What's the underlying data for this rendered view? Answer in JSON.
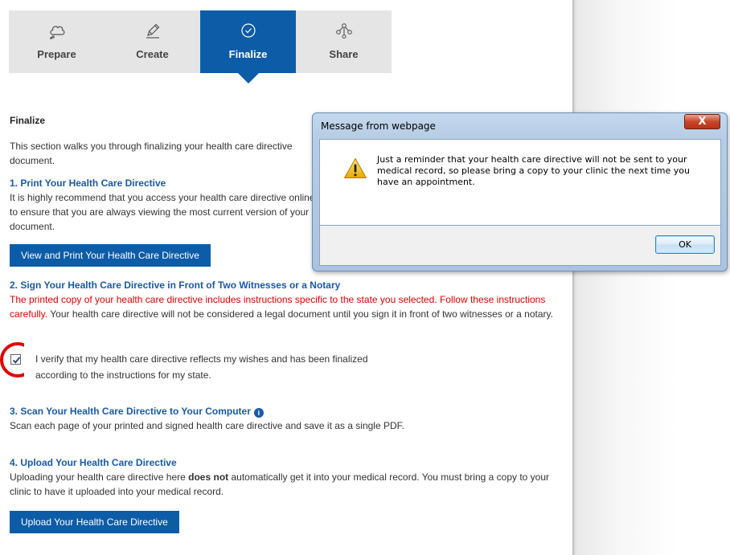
{
  "tabs": [
    {
      "label": "Prepare",
      "icon": "cloud-icon",
      "active": false
    },
    {
      "label": "Create",
      "icon": "pencil-icon",
      "active": false
    },
    {
      "label": "Finalize",
      "icon": "check-circle-icon",
      "active": true
    },
    {
      "label": "Share",
      "icon": "share-nodes-icon",
      "active": false
    }
  ],
  "content": {
    "heading": "Finalize",
    "intro": "This section walks you through finalizing your health care directive document.",
    "step1": {
      "title": "1. Print Your Health Care Directive",
      "text": "It is highly recommend that you access your health care directive online to ensure that you are always viewing the most current version of your document.",
      "button": "View and Print Your Health Care Directive"
    },
    "step2": {
      "title": "2. Sign Your Health Care Directive in Front of Two Witnesses or a Notary",
      "warning": "The printed copy of your health care directive includes instructions specific to the state you selected. Follow these instructions carefully.",
      "text": " Your health care directive will not be considered a legal document until you sign it in front of two witnesses or a notary.",
      "verify_line1": "I verify that my health care directive reflects my wishes and has been finalized",
      "verify_line2": "according to the instructions for my state.",
      "checked": true
    },
    "step3": {
      "title": "3. Scan Your Health Care Directive to Your Computer",
      "text": "Scan each page of your printed and signed health care directive and save it as a single PDF."
    },
    "step4": {
      "title": "4. Upload Your Health Care Directive",
      "text_before": "Uploading your health care directive here ",
      "text_bold": "does not",
      "text_after": " automatically get it into your medical record. You must bring a copy to your clinic to have it uploaded into your medical record.",
      "button": "Upload Your Health Care Directive"
    }
  },
  "dialog": {
    "title": "Message from webpage",
    "close_label": "X",
    "message": "Just a reminder that your health care directive will not be sent to your medical record, so please bring a copy to your clinic the next time you have an appointment.",
    "ok_label": "OK",
    "icon": "warning-icon"
  },
  "colors": {
    "accent": "#0d5ca8",
    "link_title": "#1a5aa6",
    "warning_text": "#e00000"
  }
}
